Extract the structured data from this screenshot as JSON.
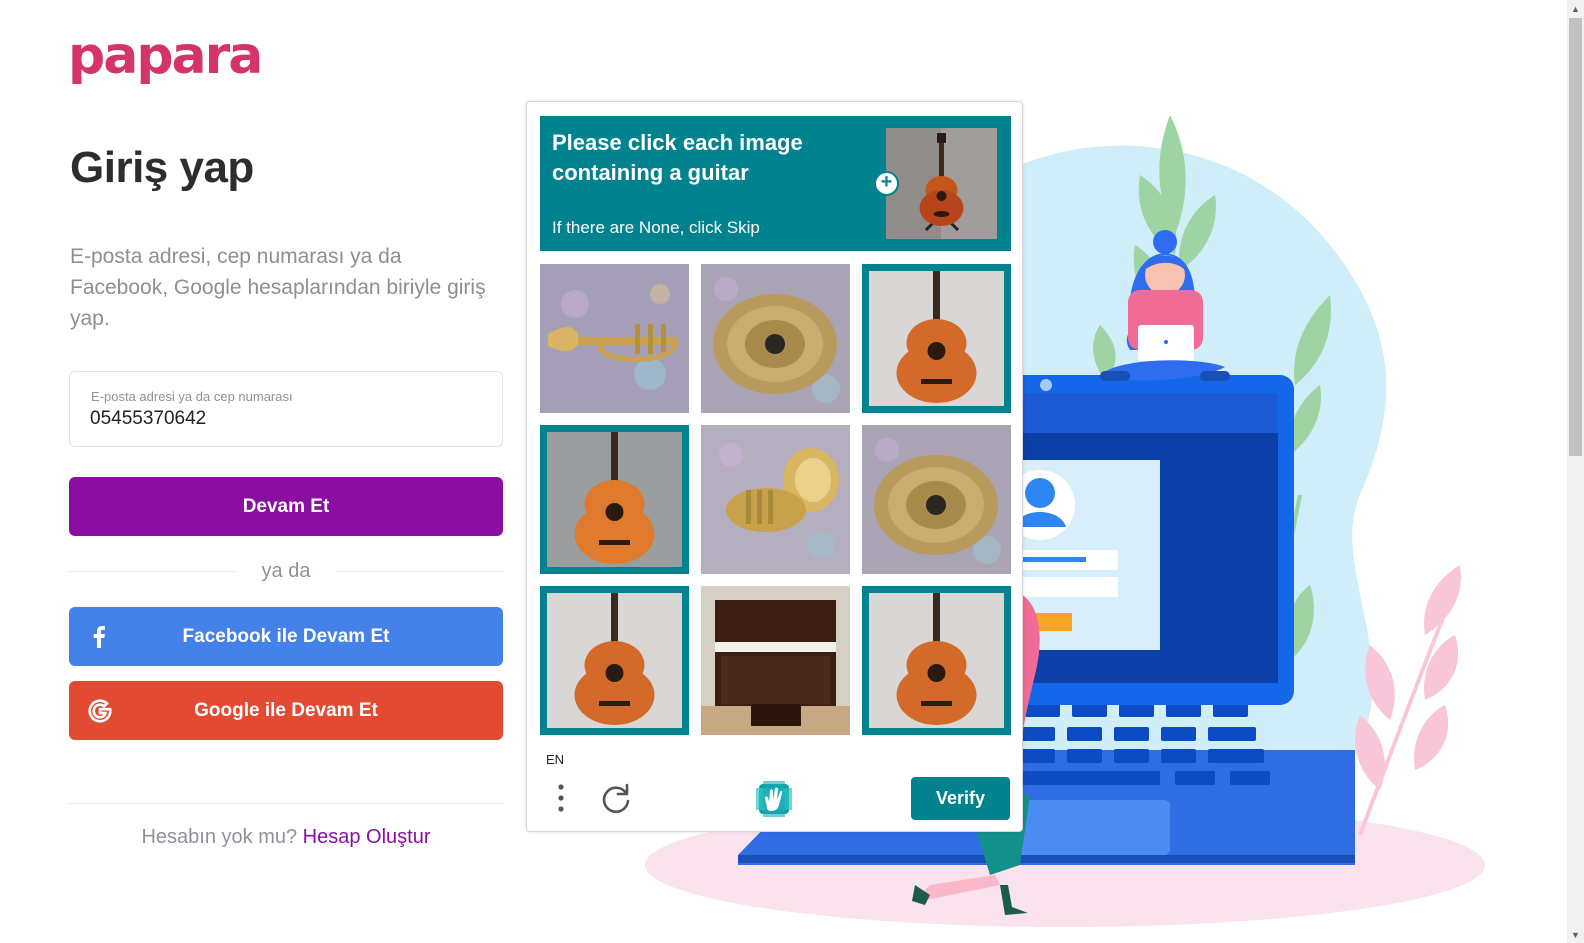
{
  "brand": {
    "logo_text": "papara",
    "accent_color": "#8b0ea3",
    "logo_color": "#d4336b"
  },
  "login": {
    "title": "Giriş yap",
    "description": "E-posta adresi, cep numarası ya da Facebook, Google hesaplarından biriyle giriş yap.",
    "field_label": "E-posta adresi ya da cep numarası",
    "field_value": "05455370642",
    "continue_label": "Devam Et",
    "or_label": "ya da",
    "facebook_label": "Facebook ile Devam Et",
    "google_label": "Google ile Devam Et",
    "signup_prompt": "Hesabın yok mu?",
    "signup_link": "Hesap Oluştur",
    "facebook_color": "#4481e8",
    "google_color": "#e24a34"
  },
  "captcha": {
    "prompt": "Please click each image containing a guitar",
    "subtext": "If there are None, click Skip",
    "language": "EN",
    "verify_label": "Verify",
    "accent_color": "#00838f",
    "tiles": [
      {
        "subject": "trumpet",
        "selected": false
      },
      {
        "subject": "cymbal",
        "selected": false
      },
      {
        "subject": "guitar",
        "selected": true
      },
      {
        "subject": "guitar",
        "selected": true
      },
      {
        "subject": "tuba",
        "selected": false
      },
      {
        "subject": "cymbal",
        "selected": false
      },
      {
        "subject": "guitar",
        "selected": true
      },
      {
        "subject": "piano",
        "selected": false
      },
      {
        "subject": "guitar",
        "selected": true
      }
    ]
  },
  "icons": {
    "facebook": "facebook-icon",
    "google": "google-icon",
    "menu": "vertical-dots-icon",
    "refresh": "refresh-icon",
    "hcaptcha": "hcaptcha-logo-icon",
    "plus": "plus-icon"
  }
}
